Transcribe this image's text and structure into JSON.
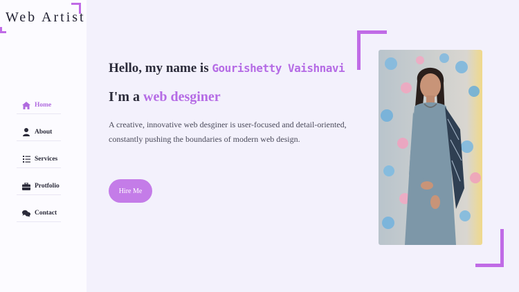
{
  "logo": {
    "text": "Web Artist"
  },
  "nav": {
    "items": [
      {
        "label": "Home",
        "icon": "home-icon",
        "active": true
      },
      {
        "label": "About",
        "icon": "user-icon",
        "active": false
      },
      {
        "label": "Services",
        "icon": "list-icon",
        "active": false
      },
      {
        "label": "Protfolio",
        "icon": "briefcase-icon",
        "active": false
      },
      {
        "label": "Contact",
        "icon": "chat-icon",
        "active": false
      }
    ]
  },
  "hero": {
    "greeting_prefix": "Hello, my name is ",
    "name": "Gourishetty Vaishnavi",
    "role_prefix": "I'm a ",
    "role": "web desginer",
    "description": "A creative, innovative web desginer is user-focused and detail-oriented, constantly pushing the boundaries of modern web design.",
    "cta_label": "Hire Me"
  },
  "photo": {
    "subject": "portrait-photo"
  },
  "colors": {
    "accent": "#c06be6",
    "background": "#f3f1fc",
    "sidebar": "#fcfbff"
  }
}
